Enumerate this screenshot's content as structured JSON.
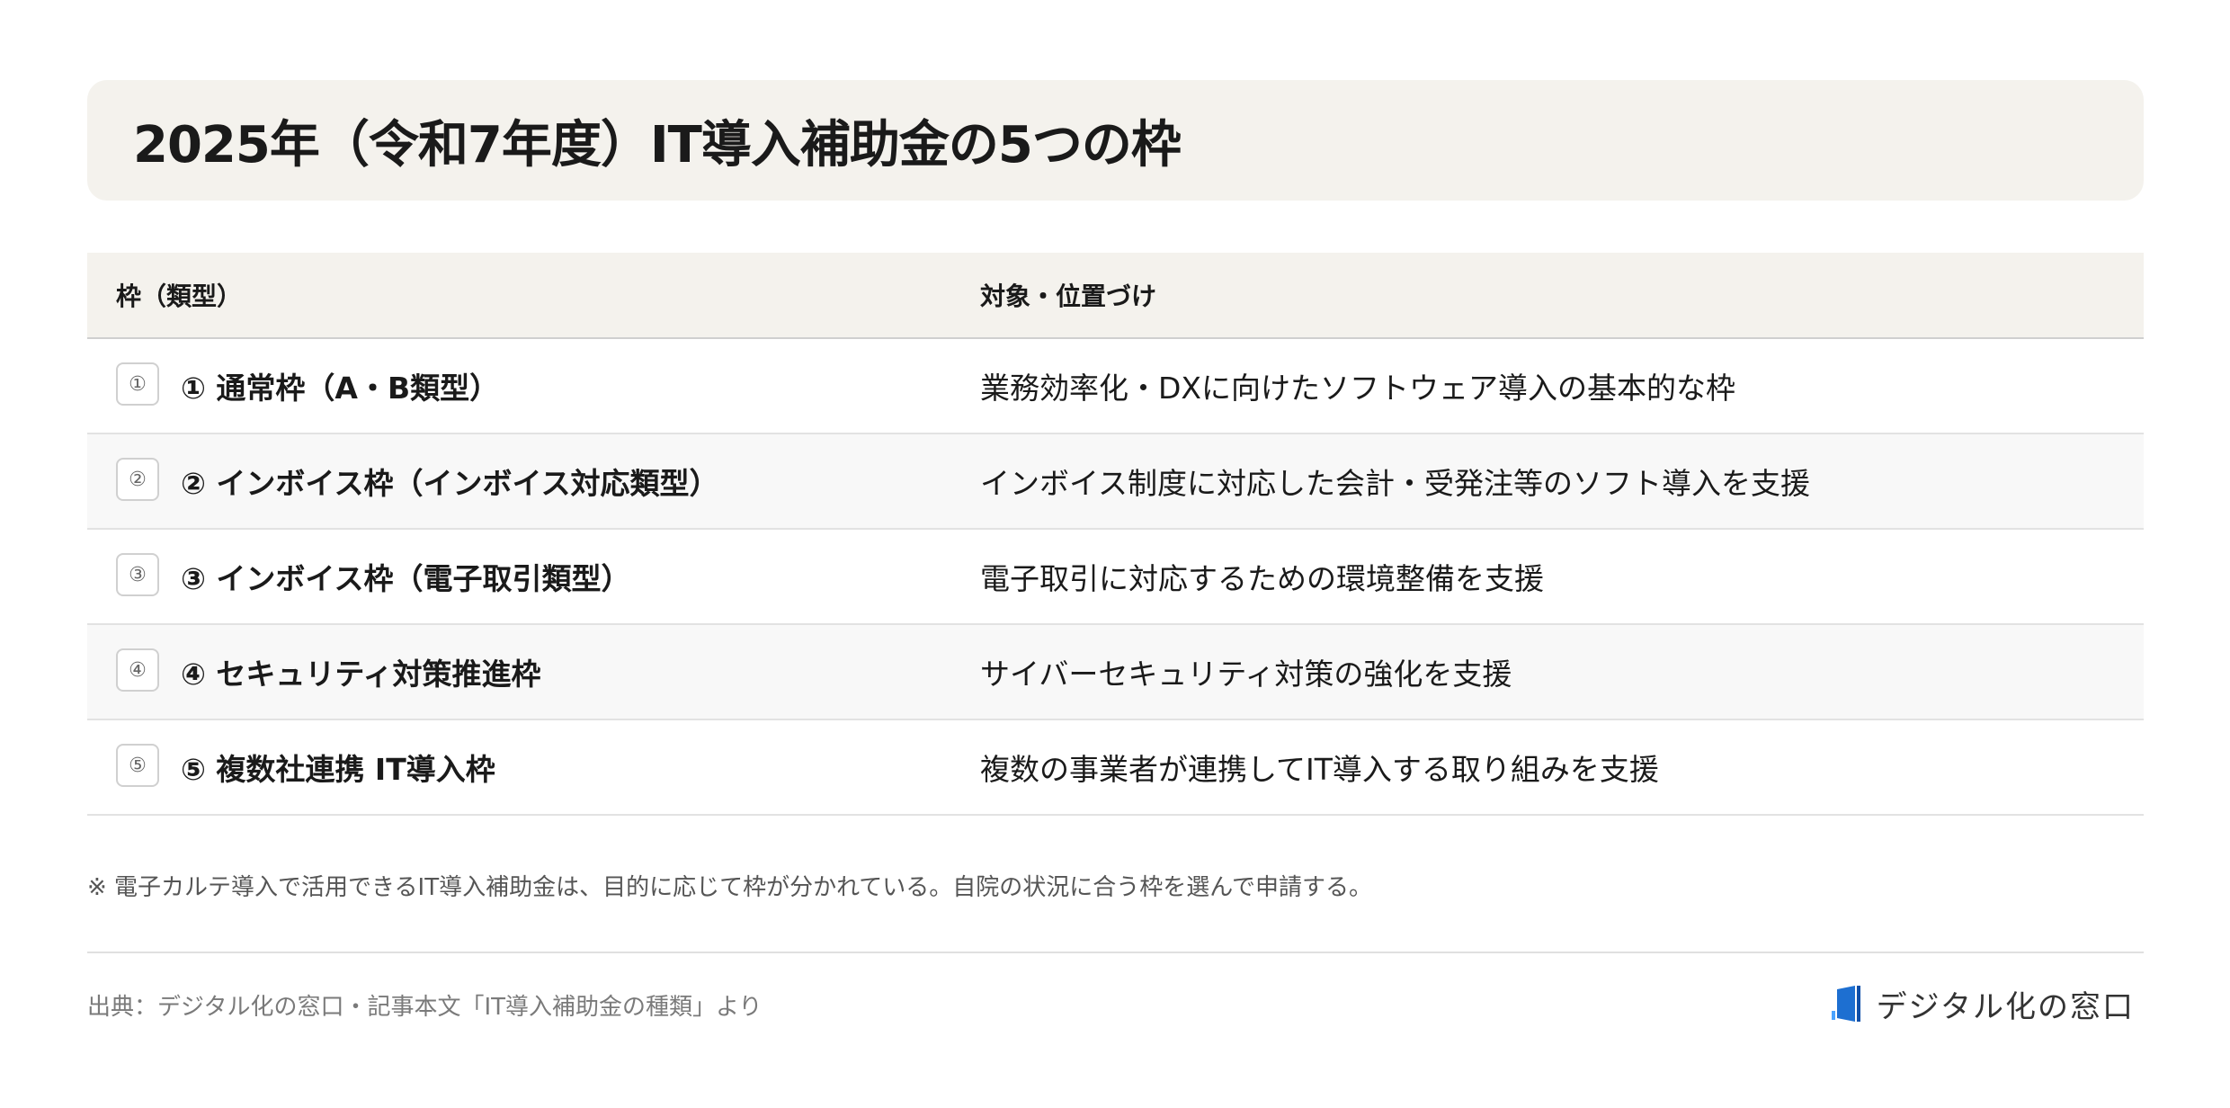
{
  "title": "2025年（令和7年度）IT導入補助金の5つの枠",
  "table": {
    "headers": [
      "枠（類型）",
      "対象・位置づけ"
    ],
    "rows": [
      {
        "badge": "①",
        "name": "① 通常枠（A・B類型）",
        "desc": "業務効率化・DXに向けたソフトウェア導入の基本的な枠"
      },
      {
        "badge": "②",
        "name": "② インボイス枠（インボイス対応類型）",
        "desc": "インボイス制度に対応した会計・受発注等のソフト導入を支援"
      },
      {
        "badge": "③",
        "name": "③ インボイス枠（電子取引類型）",
        "desc": "電子取引に対応するための環境整備を支援"
      },
      {
        "badge": "④",
        "name": "④ セキュリティ対策推進枠",
        "desc": "サイバーセキュリティ対策の強化を支援"
      },
      {
        "badge": "⑤",
        "name": "⑤ 複数社連携 IT導入枠",
        "desc": "複数の事業者が連携してIT導入する取り組みを支援"
      }
    ]
  },
  "note": "※ 電子カルテ導入で活用できるIT導入補助金は、目的に応じて枠が分かれている。自院の状況に合う枠を選んで申請する。",
  "source": "出典：デジタル化の窓口・記事本文「IT導入補助金の種類」より",
  "logo": {
    "text": "デジタル化の窓口",
    "icon": "door-logo-icon"
  },
  "colors": {
    "title_bg": "#f4f2ed",
    "header_bg": "#f4f2ed",
    "logo_blue": "#1d6fd1"
  }
}
